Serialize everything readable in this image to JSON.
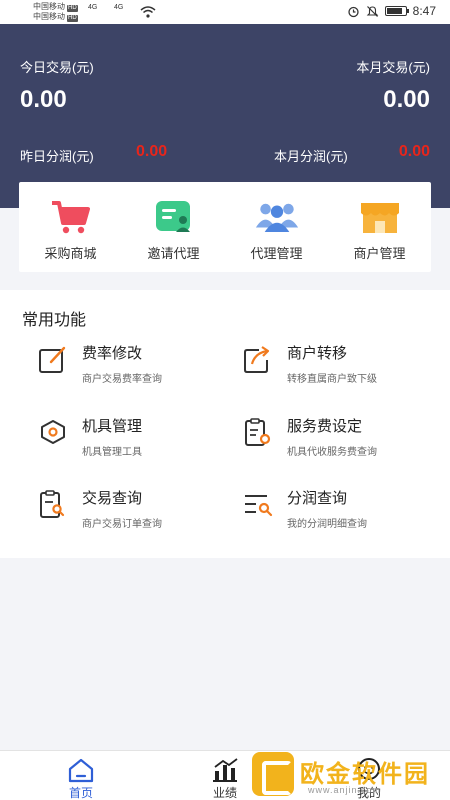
{
  "status_bar": {
    "carrier1": "中国移动",
    "carrier2": "中国移动",
    "hd": "HD",
    "net": "4G",
    "time": "8:47"
  },
  "summary": {
    "today_label": "今日交易(元)",
    "today_value": "0.00",
    "month_label": "本月交易(元)",
    "month_value": "0.00",
    "yesterday_profit_label": "昨日分润(元)",
    "yesterday_profit_value": "0.00",
    "month_profit_label": "本月分润(元)",
    "month_profit_value": "0.00"
  },
  "quick_menu": [
    {
      "label": "采购商城",
      "icon": "shopping-cart-icon"
    },
    {
      "label": "邀请代理",
      "icon": "invite-agent-icon"
    },
    {
      "label": "代理管理",
      "icon": "group-icon"
    },
    {
      "label": "商户管理",
      "icon": "store-icon"
    }
  ],
  "common": {
    "title": "常用功能",
    "features": [
      {
        "name": "费率修改",
        "desc": "商户交易费率查询",
        "icon": "edit-icon"
      },
      {
        "name": "商户转移",
        "desc": "转移直属商户致下级",
        "icon": "transfer-icon"
      },
      {
        "name": "机具管理",
        "desc": "机具管理工具",
        "icon": "device-icon"
      },
      {
        "name": "服务费设定",
        "desc": "机具代收服务费查询",
        "icon": "service-fee-icon"
      },
      {
        "name": "交易查询",
        "desc": "商户交易订单查询",
        "icon": "order-search-icon"
      },
      {
        "name": "分润查询",
        "desc": "我的分润明细查询",
        "icon": "list-search-icon"
      }
    ]
  },
  "tabbar": {
    "home": "首页",
    "performance": "业绩",
    "mine": "我的"
  },
  "watermark": {
    "text": "欧金软件园",
    "sub": "www.anjin.com"
  },
  "colors": {
    "header_bg": "#3d4466",
    "profit_red": "#e8251b",
    "accent_orange": "#f07a1e",
    "tab_active": "#2f5fd6"
  }
}
